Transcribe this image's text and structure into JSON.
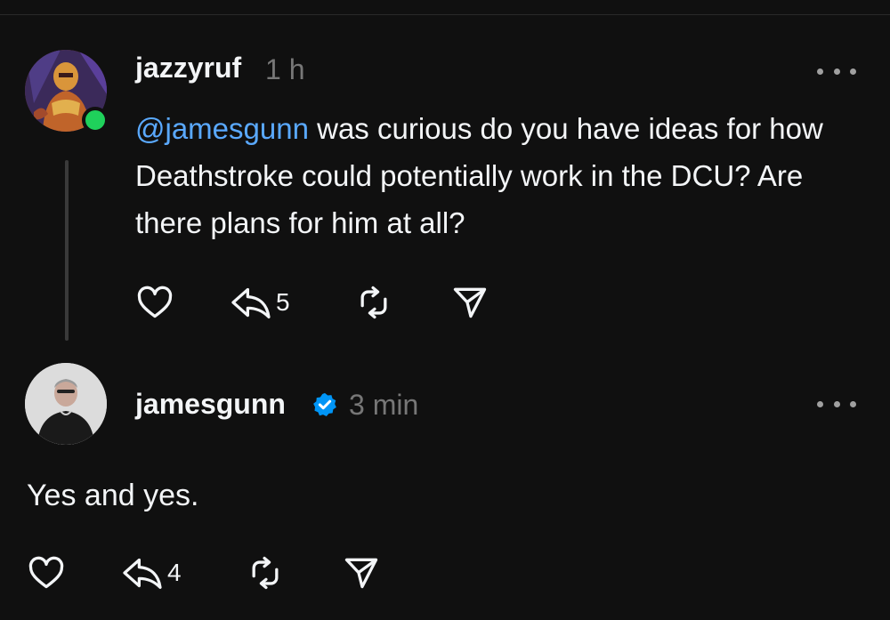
{
  "posts": [
    {
      "username": "jazzyruf",
      "time": "1 h",
      "mention": "@jamesgunn",
      "text": " was curious do you have ideas for how Deathstroke could potentially work in the DCU? Are there plans for him at all?",
      "reply_count": "5",
      "online": true
    },
    {
      "username": "jamesgunn",
      "time": "3 min",
      "verified": true,
      "text": "Yes and yes.",
      "reply_count": "4"
    }
  ],
  "icons": {
    "like": "heart-icon",
    "reply": "reply-icon",
    "repost": "repost-icon",
    "share": "send-icon",
    "more": "more-dots-icon",
    "verified": "verified-badge-icon"
  },
  "colors": {
    "background": "#101010",
    "text": "#f3f5f7",
    "muted": "#777777",
    "mention": "#5aa9ff",
    "verified": "#0095f6",
    "online": "#1fd15b"
  }
}
